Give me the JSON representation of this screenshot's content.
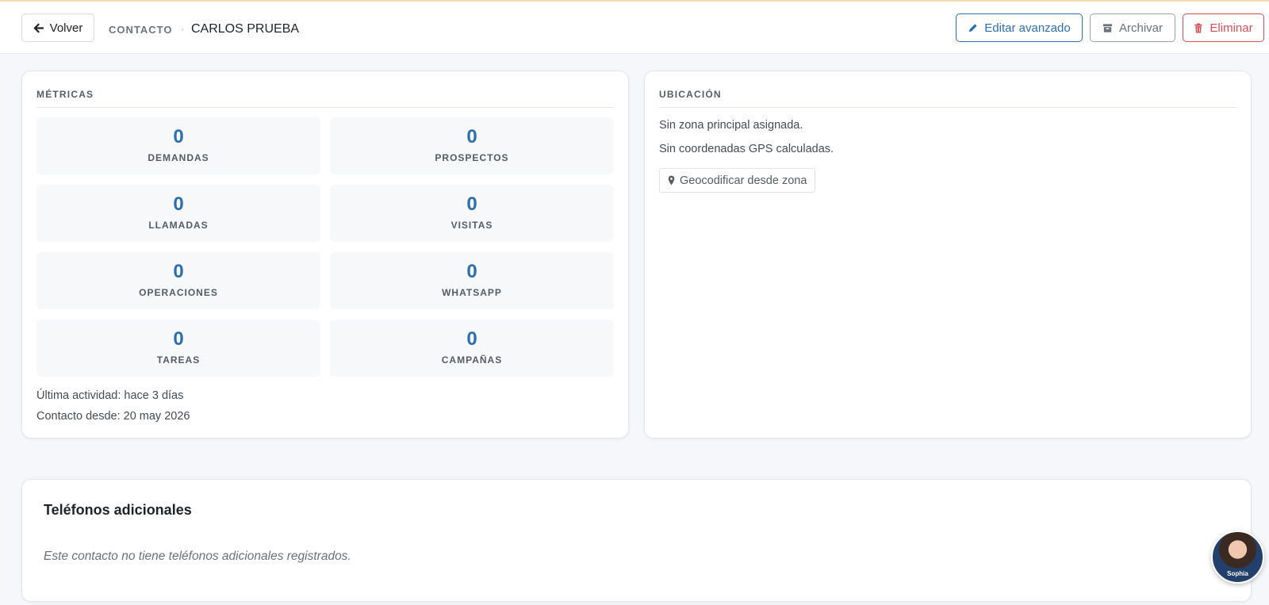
{
  "header": {
    "back_label": "Volver",
    "breadcrumb_section": "CONTACTO",
    "breadcrumb_separator": "·",
    "contact_name": "CARLOS PRUEBA",
    "edit_label": "Editar avanzado",
    "archive_label": "Archivar",
    "delete_label": "Eliminar"
  },
  "metrics": {
    "title": "MÉTRICAS",
    "items": [
      {
        "value": "0",
        "label": "DEMANDAS"
      },
      {
        "value": "0",
        "label": "PROSPECTOS"
      },
      {
        "value": "0",
        "label": "LLAMADAS"
      },
      {
        "value": "0",
        "label": "VISITAS"
      },
      {
        "value": "0",
        "label": "OPERACIONES"
      },
      {
        "value": "0",
        "label": "WHATSAPP"
      },
      {
        "value": "0",
        "label": "TAREAS"
      },
      {
        "value": "0",
        "label": "CAMPAÑAS"
      }
    ],
    "last_activity": "Última actividad: hace 3 días",
    "contact_since": "Contacto desde: 20 may 2026"
  },
  "location": {
    "title": "UBICACIÓN",
    "no_zone": "Sin zona principal asignada.",
    "no_gps": "Sin coordenadas GPS calculadas.",
    "geocode_label": "Geocodificar desde zona"
  },
  "phones": {
    "title": "Teléfonos adicionales",
    "empty_text": "Este contacto no tiene teléfonos adicionales registrados."
  },
  "assistant": {
    "name": "Sophia"
  },
  "colors": {
    "accent": "#2c6fb0",
    "danger": "#dc4d52",
    "muted": "#6b7178"
  }
}
